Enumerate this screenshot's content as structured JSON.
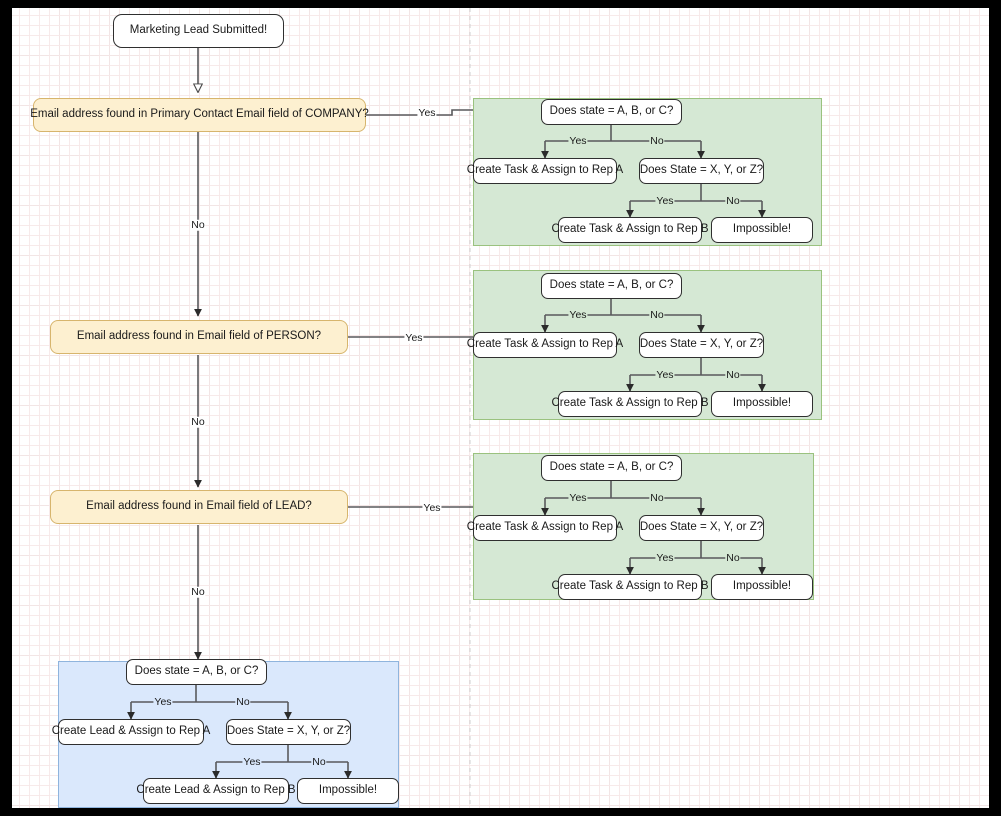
{
  "diagram": {
    "title_node": {
      "label": "Marketing Lead Submitted!"
    },
    "main_branches": [
      {
        "id": "company",
        "question": "Email address found in Primary Contact Email field of COMPANY?",
        "yes_label": "Yes",
        "no_label": "No"
      },
      {
        "id": "person",
        "question": "Email address found in Email field of PERSON?",
        "yes_label": "Yes",
        "no_label": "No"
      },
      {
        "id": "lead",
        "question": "Email address found in Email field of LEAD?",
        "yes_label": "Yes",
        "no_label": "No"
      }
    ],
    "subflows": [
      {
        "id": "company-subflow",
        "color": "green",
        "decision_1": "Does state = A, B, or C?",
        "decision_1_yes": "Yes",
        "decision_1_no": "No",
        "action_a": "Create Task & Assign to Rep A",
        "decision_2": "Does State = X, Y, or Z?",
        "decision_2_yes": "Yes",
        "decision_2_no": "No",
        "action_b": "Create Task & Assign to Rep B",
        "action_impossible": "Impossible!"
      },
      {
        "id": "person-subflow",
        "color": "green",
        "decision_1": "Does state = A, B, or C?",
        "decision_1_yes": "Yes",
        "decision_1_no": "No",
        "action_a": "Create Task & Assign to Rep A",
        "decision_2": "Does State = X, Y, or Z?",
        "decision_2_yes": "Yes",
        "decision_2_no": "No",
        "action_b": "Create Task & Assign to Rep B",
        "action_impossible": "Impossible!"
      },
      {
        "id": "lead-subflow",
        "color": "green",
        "decision_1": "Does state = A, B, or C?",
        "decision_1_yes": "Yes",
        "decision_1_no": "No",
        "action_a": "Create Task & Assign to Rep A",
        "decision_2": "Does State = X, Y, or Z?",
        "decision_2_yes": "Yes",
        "decision_2_no": "No",
        "action_b": "Create Task & Assign to Rep B",
        "action_impossible": "Impossible!"
      },
      {
        "id": "new-lead-subflow",
        "color": "blue",
        "decision_1": "Does state = A, B, or C?",
        "decision_1_yes": "Yes",
        "decision_1_no": "No",
        "action_a": "Create Lead & Assign to Rep A",
        "decision_2": "Does State = X, Y, or Z?",
        "decision_2_yes": "Yes",
        "decision_2_no": "No",
        "action_b": "Create Lead & Assign to Rep B",
        "action_impossible": "Impossible!"
      }
    ],
    "colors": {
      "group_green_fill": "#d5e8d4",
      "group_green_border": "#9ac27f",
      "group_blue_fill": "#dae8fc",
      "group_blue_border": "#8fb4dd",
      "decision_yellow_fill": "#fdf0d0",
      "decision_yellow_border": "#d7b56d",
      "node_fill": "#ffffff",
      "node_border": "#2f2f2f",
      "connector": "#59595c",
      "page_frame": "#000000"
    }
  }
}
